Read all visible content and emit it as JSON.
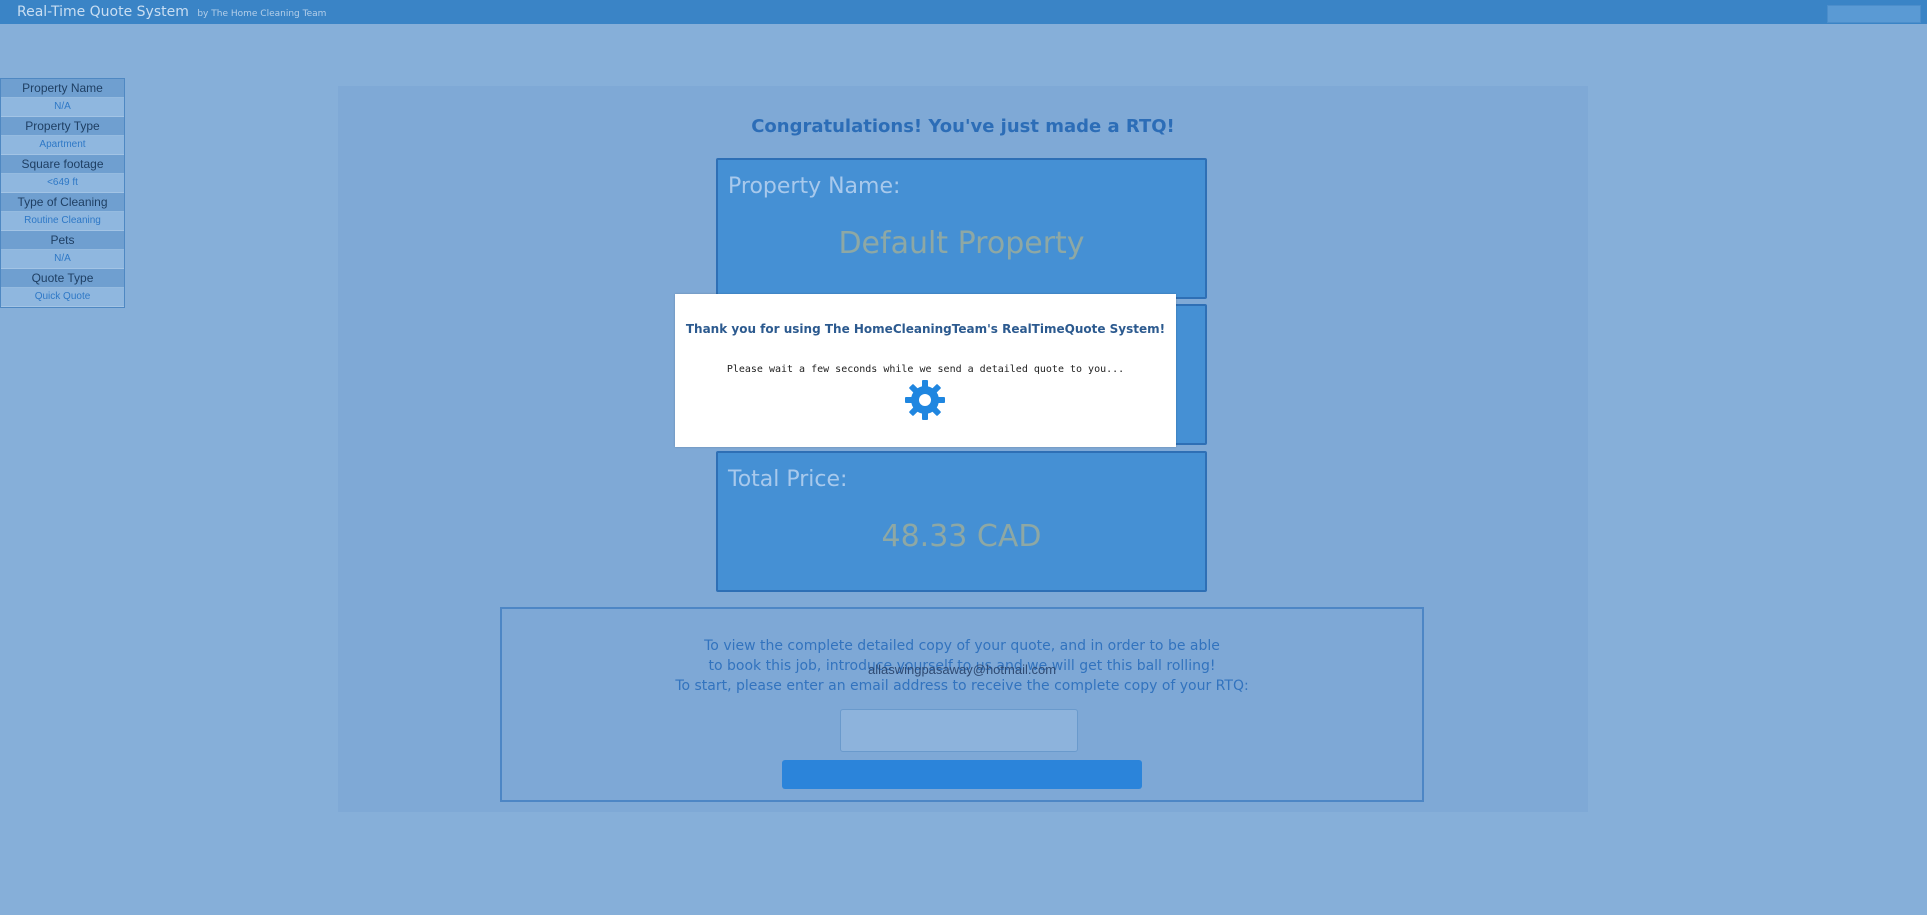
{
  "header": {
    "title": "Real-Time Quote System",
    "subtitle": "by The Home Cleaning Team"
  },
  "sidebar": {
    "items": [
      {
        "label": "Property Name",
        "value": "N/A"
      },
      {
        "label": "Property Type",
        "value": "Apartment"
      },
      {
        "label": "Square footage",
        "value": "<649 ft"
      },
      {
        "label": "Type of Cleaning",
        "value": "Routine Cleaning"
      },
      {
        "label": "Pets",
        "value": "N/A"
      },
      {
        "label": "Quote Type",
        "value": "Quick Quote"
      }
    ]
  },
  "main": {
    "heading": "Congratulations! You've just made a RTQ!",
    "cards": [
      {
        "title": "Property Name:",
        "value": "Default Property"
      },
      {
        "title": "",
        "value": ""
      },
      {
        "title": "Total Price:",
        "value": "48.33 CAD"
      }
    ],
    "email_section": {
      "line1": "To view the complete detailed copy of your quote, and in order to be able",
      "line2": "to book this job, introduce yourself to us and we will get this ball rolling!",
      "line3": "To start, please enter an email address to receive the complete copy of your RTQ:",
      "email_value": "allaswingpasaway@hotmail.com",
      "input_value": "",
      "button_label": ""
    }
  },
  "modal": {
    "title": "Thank you for using The HomeCleaningTeam's RealTimeQuote System!",
    "message": "Please wait a few seconds while we send a detailed quote to you...",
    "spinner_icon": "gear-icon",
    "accent_color": "#1f86e0"
  }
}
